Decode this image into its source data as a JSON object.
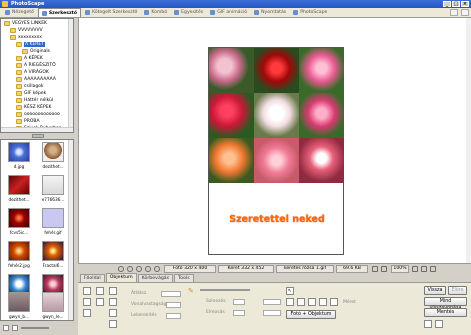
{
  "app": {
    "title": "PhotoScape"
  },
  "tabs": [
    {
      "label": "Nézegető"
    },
    {
      "label": "Szerkesztő"
    },
    {
      "label": "Kötegelt Szerkesztő"
    },
    {
      "label": "Kombó"
    },
    {
      "label": "Egyesítés"
    },
    {
      "label": "GIF animáció"
    },
    {
      "label": "Nyomtatás"
    },
    {
      "label": "PhotoScape"
    }
  ],
  "tree": [
    {
      "label": "VEGYES LINKEK"
    },
    {
      "label": "VVVVVVVV"
    },
    {
      "label": "xxxxxxxxx"
    },
    {
      "label": "A KERET"
    },
    {
      "label": "Originals"
    },
    {
      "label": "A KÉPEK"
    },
    {
      "label": "A RIEGÉSZITŐ"
    },
    {
      "label": "A VIRÁGOK"
    },
    {
      "label": "AAAAAAAAAA"
    },
    {
      "label": "csillagok"
    },
    {
      "label": "GIF képek"
    },
    {
      "label": "Háttér nélkül"
    },
    {
      "label": "KÉSZ KÉPEK"
    },
    {
      "label": "ooooooooooooo"
    },
    {
      "label": "PROBA"
    },
    {
      "label": "Szivek Ruberban"
    }
  ],
  "thumbnails": [
    {
      "label": "d.jpg"
    },
    {
      "label": "dezithet..."
    },
    {
      "label": "dezithet..."
    },
    {
      "label": "e776636..."
    },
    {
      "label": "fcvs5ic..."
    },
    {
      "label": "fehér.gif"
    },
    {
      "label": "fehér2.jpg"
    },
    {
      "label": "Fractal6..."
    },
    {
      "label": "l3_4k.png"
    },
    {
      "label": "gwyn_a..."
    },
    {
      "label": "gwyn_b..."
    },
    {
      "label": "gwyn_le..."
    }
  ],
  "canvas": {
    "caption": "Szeretettel neked"
  },
  "status": {
    "photo_size": "Fotó 320 x 400",
    "frame_size": "Keret 332 x 452",
    "frame_name": "keretes rózsa 1.gif",
    "file_size": "69.6 KB",
    "zoom": "100%"
  },
  "edit_tabs": [
    {
      "label": "Főoldal"
    },
    {
      "label": "Objektum"
    },
    {
      "label": "Körbevágás"
    },
    {
      "label": "Tools"
    }
  ],
  "panel": {
    "labels": [
      "Átlátsz.",
      "Vonalvastagság",
      "Lekerekítés",
      "Színezés",
      "Elmosás",
      "Méret"
    ],
    "undo": "Vissza",
    "redo": "Előre",
    "undo_all": "Mind visszavonása",
    "save": "Mentés",
    "photo_object": "Fotó + Objektum"
  },
  "colors": {
    "accent": "#2456c4",
    "caption": "#ff6a00"
  }
}
